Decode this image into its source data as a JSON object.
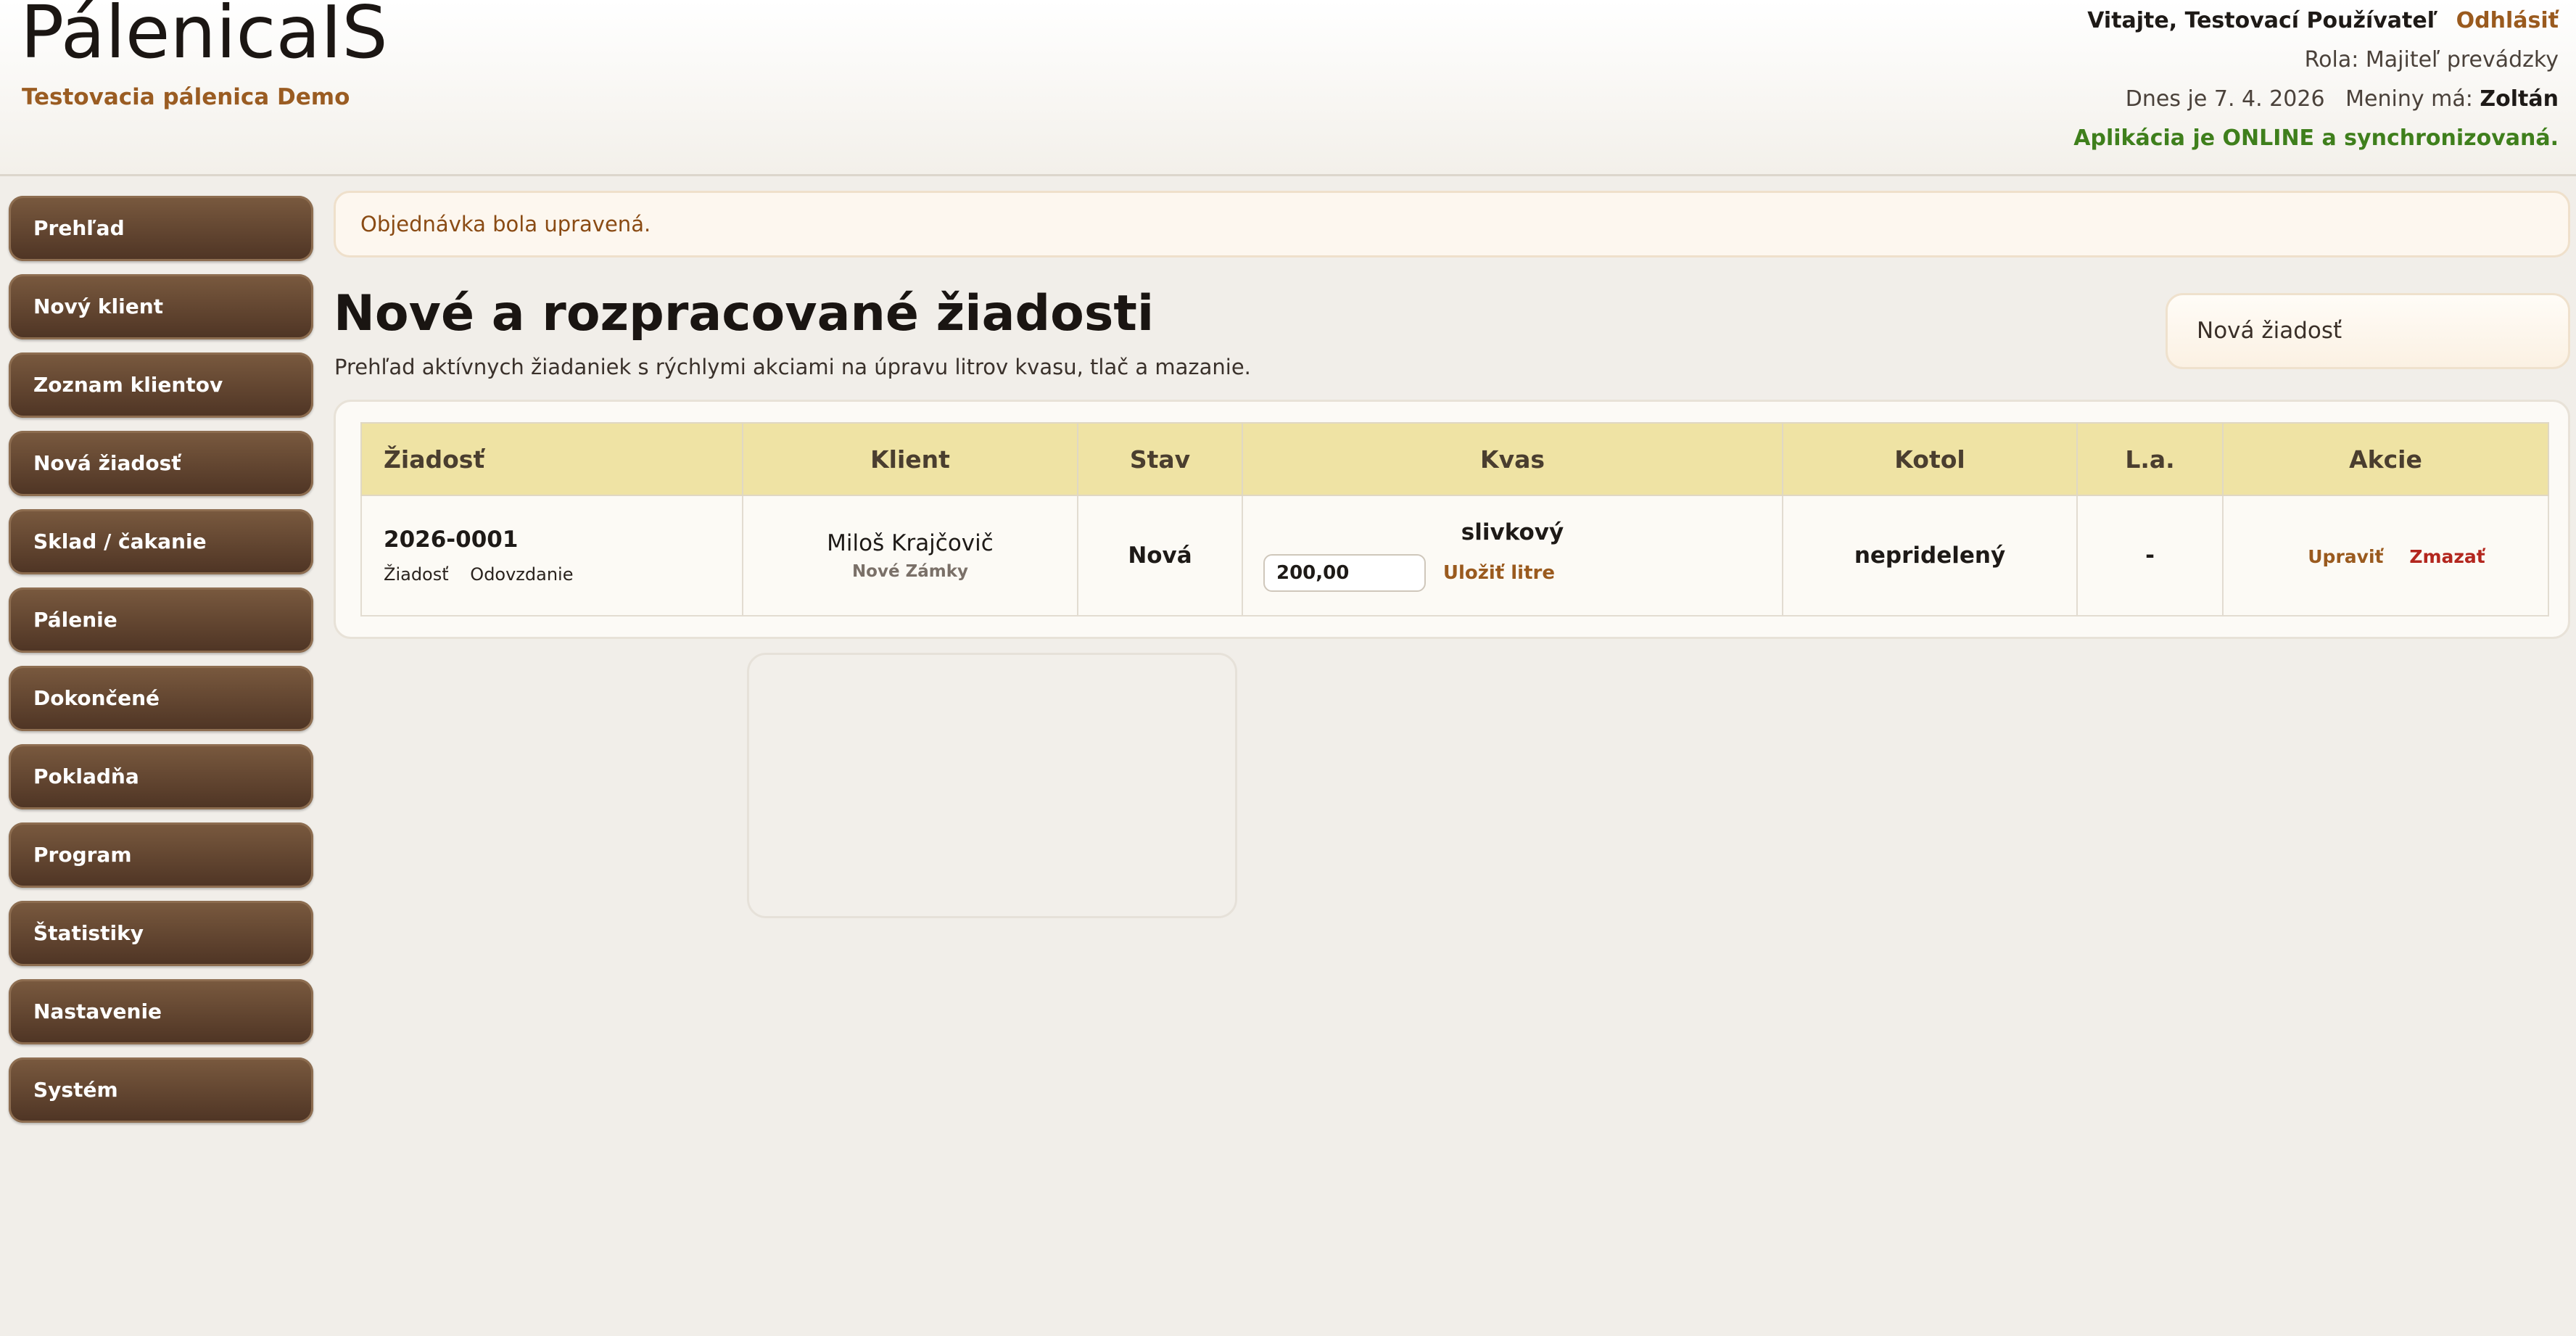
{
  "header": {
    "brand_title": "PálenicaIS",
    "brand_subtitle": "Testovacia pálenica Demo",
    "welcome": "Vitajte, Testovací Používateľ",
    "logout": "Odhlásiť",
    "role": "Rola: Majiteľ prevádzky",
    "date": "Dnes je 7. 4. 2026",
    "nameday_label": "Meniny má:",
    "nameday_name": "Zoltán",
    "online_status": "Aplikácia je ONLINE a synchronizovaná."
  },
  "sidebar": {
    "items": [
      {
        "label": "Prehľad"
      },
      {
        "label": "Nový klient"
      },
      {
        "label": "Zoznam klientov"
      },
      {
        "label": "Nová žiadosť"
      },
      {
        "label": "Sklad / čakanie"
      },
      {
        "label": "Pálenie"
      },
      {
        "label": "Dokončené"
      },
      {
        "label": "Pokladňa"
      },
      {
        "label": "Program"
      },
      {
        "label": "Štatistiky"
      },
      {
        "label": "Nastavenie"
      },
      {
        "label": "Systém"
      }
    ]
  },
  "main": {
    "alert": "Objednávka bola upravená.",
    "title": "Nové a rozpracované žiadosti",
    "subtitle": "Prehľad aktívnych žiadaniek s rýchlymi akciami na úpravu litrov kvasu, tlač a mazanie.",
    "new_request_button": "Nová žiadosť",
    "table": {
      "headers": {
        "request": "Žiadosť",
        "client": "Klient",
        "status": "Stav",
        "mash": "Kvas",
        "boiler": "Kotol",
        "la": "L.a.",
        "actions": "Akcie"
      },
      "rows": [
        {
          "id": "2026-0001",
          "link_request": "Žiadosť",
          "link_handover": "Odovzdanie",
          "client_name": "Miloš Krajčovič",
          "client_town": "Nové Zámky",
          "status": "Nová",
          "mash_type": "slivkový",
          "liters": "200,00",
          "save_liters": "Uložiť litre",
          "boiler": "nepridelený",
          "la": "-",
          "edit": "Upraviť",
          "delete": "Zmazať"
        }
      ]
    }
  }
}
